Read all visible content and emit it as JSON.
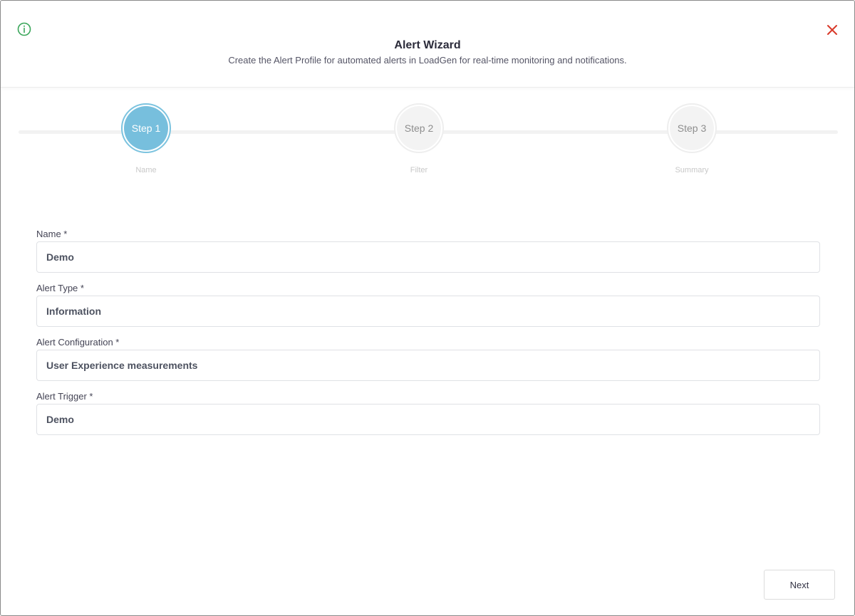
{
  "header": {
    "title": "Alert Wizard",
    "subtitle": "Create the Alert Profile for automated alerts in LoadGen for real-time monitoring and notifications.",
    "info_icon": "info-icon",
    "close_icon": "close-icon",
    "info_color": "#3aa65a",
    "close_color": "#d93a2b"
  },
  "stepper": {
    "accent_color": "#77bfdd",
    "steps": [
      {
        "label": "Step 1",
        "caption": "Name",
        "state": "active"
      },
      {
        "label": "Step 2",
        "caption": "Filter",
        "state": "inactive"
      },
      {
        "label": "Step 3",
        "caption": "Summary",
        "state": "inactive"
      }
    ]
  },
  "form": {
    "name": {
      "label": "Name *",
      "value": "Demo"
    },
    "alert_type": {
      "label": "Alert Type *",
      "value": "Information"
    },
    "alert_configuration": {
      "label": "Alert Configuration *",
      "value": "User Experience measurements"
    },
    "alert_trigger": {
      "label": "Alert Trigger *",
      "value": "Demo"
    }
  },
  "footer": {
    "next_label": "Next"
  }
}
